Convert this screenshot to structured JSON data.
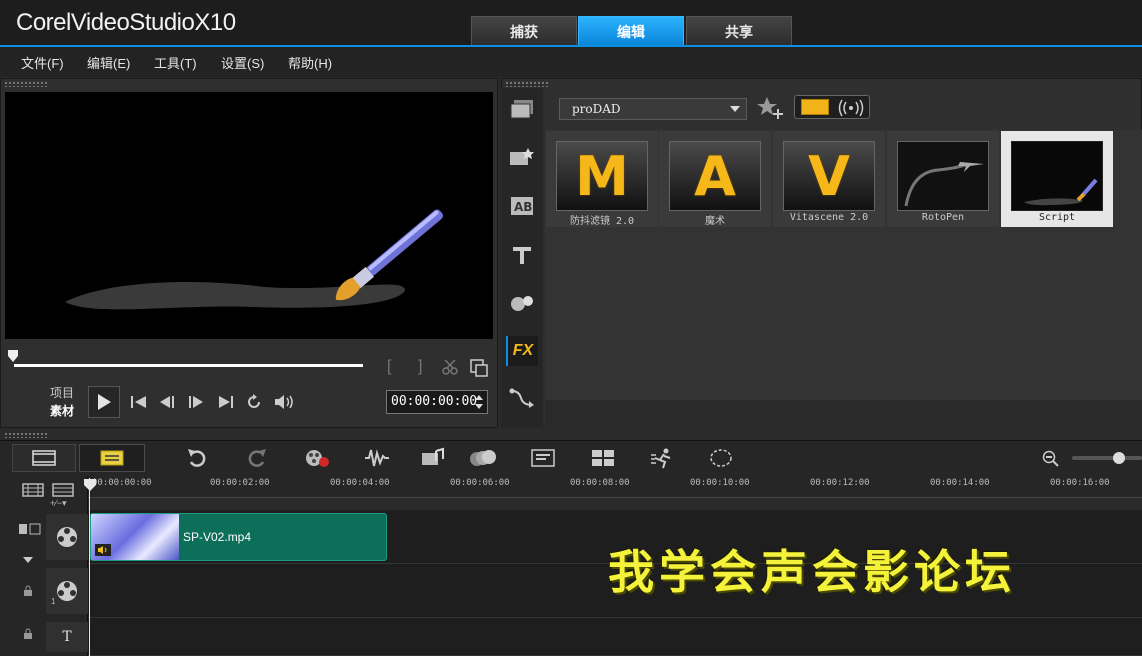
{
  "app": {
    "brand_corel": "Corel",
    "brand_product": "VideoStudio",
    "brand_version": "X10"
  },
  "mode_tabs": [
    {
      "label": "捕获",
      "active": false
    },
    {
      "label": "编辑",
      "active": true
    },
    {
      "label": "共享",
      "active": false
    }
  ],
  "menu": [
    "文件(F)",
    "编辑(E)",
    "工具(T)",
    "设置(S)",
    "帮助(H)"
  ],
  "player": {
    "mode_project": "项目",
    "mode_clip": "素材",
    "timecode": "00:00:00:00",
    "bracket_in": "[",
    "bracket_out": "]"
  },
  "library": {
    "dropdown_value": "proDAD",
    "items": [
      {
        "letter": "M",
        "label": "防抖滤镜 2.0",
        "selected": false
      },
      {
        "letter": "A",
        "label": "魔术",
        "selected": false
      },
      {
        "letter": "V",
        "label": "Vitascene 2.0",
        "selected": false
      },
      {
        "letter": "",
        "label": "RotoPen",
        "selected": false
      },
      {
        "letter": "",
        "label": "Script",
        "selected": true
      }
    ],
    "fx_label": "FX"
  },
  "timeline": {
    "ruler_ticks": [
      "00:00:00:00",
      "00:00:02:00",
      "00:00:04:00",
      "00:00:06:00",
      "00:00:08:00",
      "00:00:10:00",
      "00:00:12:00",
      "00:00:14:00",
      "00:00:16:00"
    ],
    "clip_name": "SP-V02.mp4",
    "track_one_index": "1",
    "title_track_glyph": "T"
  },
  "watermark": "我学会声会影论坛",
  "colors": {
    "accent": "#0b8fe0",
    "clip": "#0d6e5a",
    "gold": "#f6b819",
    "watermark": "#f4f23a"
  }
}
